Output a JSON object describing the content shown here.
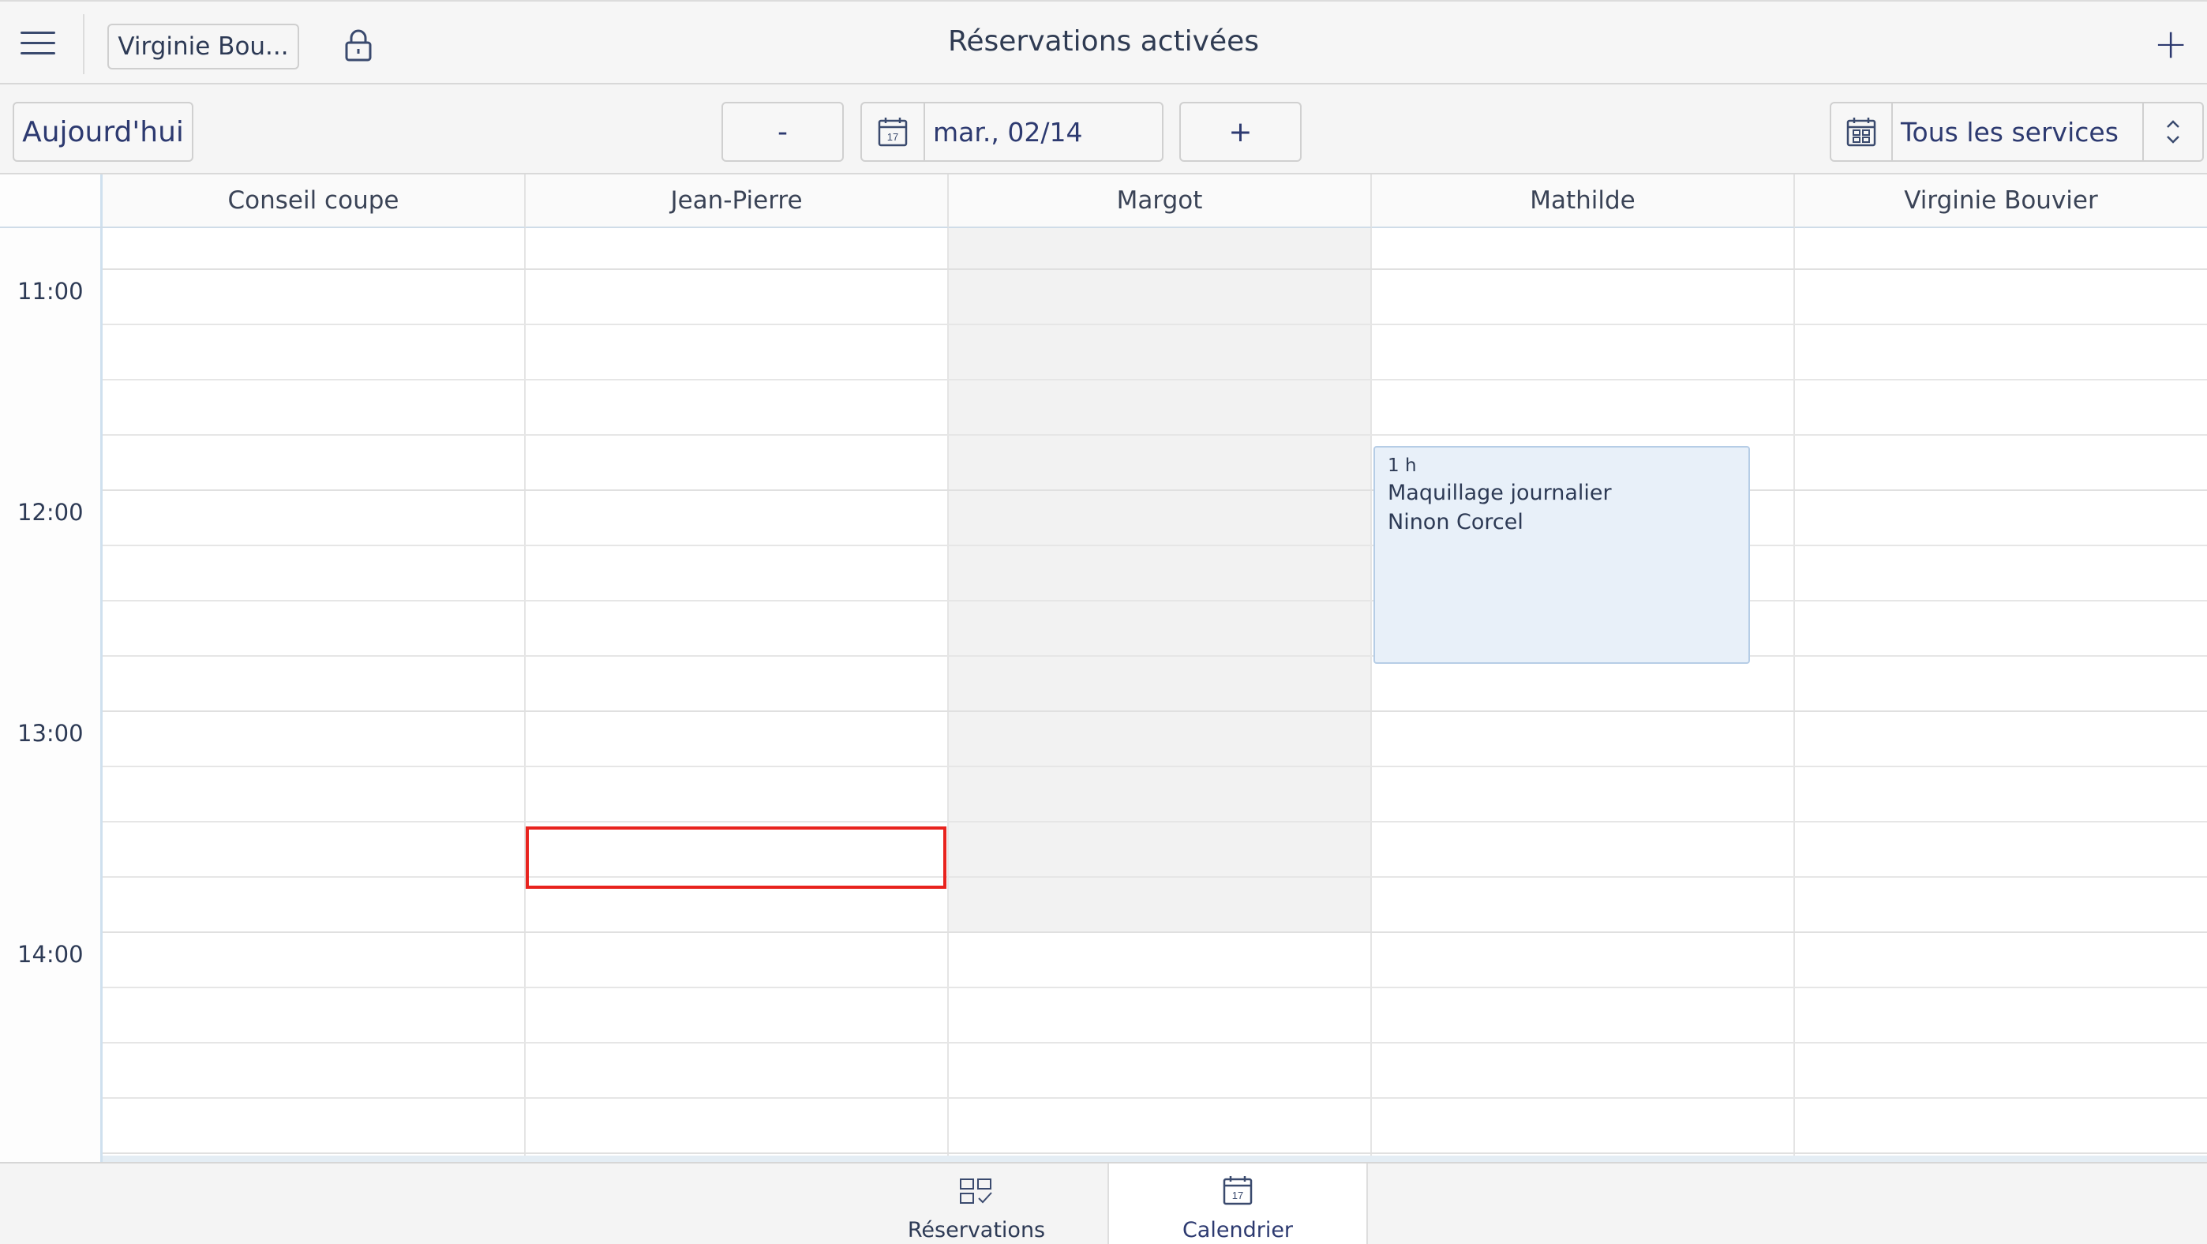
{
  "header": {
    "title": "Réservations activées",
    "user_button": "Virginie Bou...",
    "menu_icon": "hamburger-menu-icon",
    "lock_icon": "lock-icon",
    "add_label": "+"
  },
  "toolbar": {
    "today_label": "Aujourd'hui",
    "prev_label": "-",
    "date_value": "mar., 02/14",
    "calendar_day": "17",
    "next_label": "+",
    "services_value": "Tous les services"
  },
  "calendar": {
    "columns": [
      "Conseil coupe",
      "Jean-Pierre",
      "Margot",
      "Mathilde",
      "Virginie Bouvier"
    ],
    "hours": [
      "11:00",
      "12:00",
      "13:00",
      "14:00"
    ],
    "unavailable_column": "Margot",
    "event": {
      "duration": "1 h",
      "service": "Maquillage journalier",
      "client": "Ninon Corcel",
      "staff": "Mathilde"
    },
    "selected_slot_staff": "Jean-Pierre"
  },
  "tabs": [
    {
      "label": "Réservations",
      "icon": "reservations-grid-icon",
      "active": false
    },
    {
      "label": "Calendrier",
      "icon": "calendar-icon",
      "active": true
    }
  ],
  "colors": {
    "accent": "#2d3a70",
    "event_bg": "#e8f0f9",
    "selection": "#e8231e",
    "unavailable": "#f2f2f2"
  }
}
